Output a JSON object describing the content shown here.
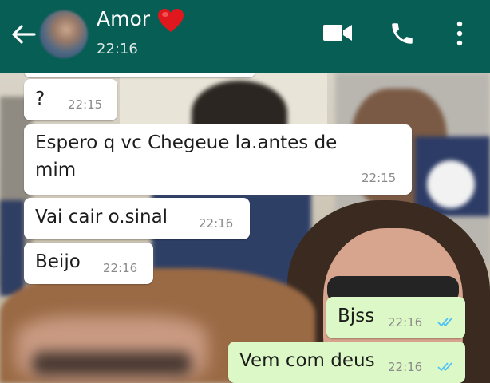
{
  "header": {
    "contact_name": "Amor",
    "last_seen": "22:16",
    "heart_emoji": "heart-emoji",
    "color": "#075e54",
    "icons": [
      "back-arrow-icon",
      "video-call-icon",
      "phone-icon",
      "more-vert-icon"
    ]
  },
  "messages": [
    {
      "direction": "in",
      "text": "?",
      "time": "22:15"
    },
    {
      "direction": "in",
      "text_line1": "Espero q vc Chegeue la.antes de",
      "text_line2": "mim",
      "time": "22:15"
    },
    {
      "direction": "in",
      "text": "Vai cair o.sinal",
      "time": "22:16"
    },
    {
      "direction": "in",
      "text": "Beijo",
      "time": "22:16"
    },
    {
      "direction": "out",
      "text": "Bjss",
      "time": "22:16",
      "status": "read"
    },
    {
      "direction": "out",
      "text": "Vem com deus",
      "time": "22:16",
      "status": "read"
    }
  ],
  "colors": {
    "incoming_bubble": "#ffffff",
    "outgoing_bubble": "#dcf8c6",
    "read_ticks": "#4fc3f7"
  }
}
